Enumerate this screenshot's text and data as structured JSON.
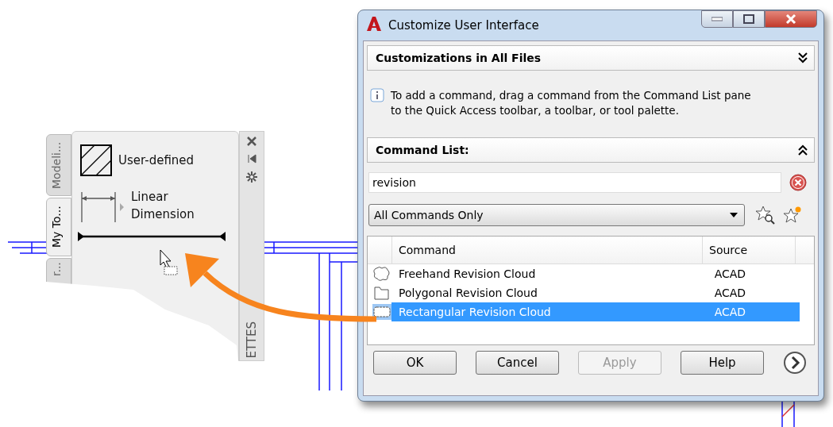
{
  "palette": {
    "tabs": [
      {
        "label": "Modeli...",
        "selected": false
      },
      {
        "label": "My To...",
        "selected": true
      },
      {
        "label": "r...",
        "selected": false
      }
    ],
    "tools": [
      {
        "kind": "hatch",
        "label": "User-defined"
      },
      {
        "kind": "dimension",
        "label": "Linear Dimension"
      }
    ],
    "side_label": "ETTES"
  },
  "dialog": {
    "title": "Customize User Interface",
    "customizations_pane": {
      "title": "Customizations in All Files",
      "expanded": false
    },
    "info": "To add a command, drag a command from the Command List pane to the Quick Access toolbar, a toolbar, or tool palette.",
    "command_list_pane": {
      "title": "Command List:",
      "expanded": true
    },
    "search": {
      "value": "revision"
    },
    "filter": {
      "value": "All Commands Only"
    },
    "table": {
      "columns": [
        "Command",
        "Source"
      ],
      "rows": [
        {
          "kind": "freehand",
          "command": "Freehand Revision Cloud",
          "source": "ACAD",
          "selected": false
        },
        {
          "kind": "polygonal",
          "command": "Polygonal Revision Cloud",
          "source": "ACAD",
          "selected": false
        },
        {
          "kind": "rectangular",
          "command": "Rectangular Revision Cloud",
          "source": "ACAD",
          "selected": true
        }
      ]
    },
    "buttons": [
      {
        "label": "OK",
        "disabled": false
      },
      {
        "label": "Cancel",
        "disabled": false
      },
      {
        "label": "Apply",
        "disabled": true
      },
      {
        "label": "Help",
        "disabled": false
      }
    ]
  }
}
